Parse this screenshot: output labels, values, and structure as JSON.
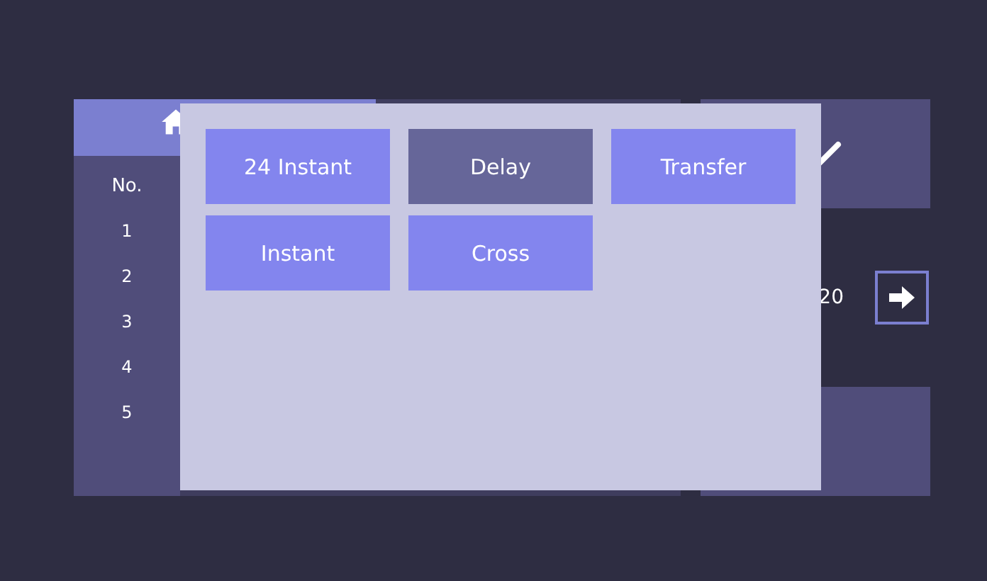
{
  "table": {
    "columns": [
      "No."
    ],
    "rows": [
      "1",
      "2",
      "3",
      "4",
      "5"
    ]
  },
  "side": {
    "value": "20"
  },
  "popup": {
    "options": [
      {
        "label": "24 Instant",
        "selected": false
      },
      {
        "label": "Delay",
        "selected": true
      },
      {
        "label": "Transfer",
        "selected": false
      },
      {
        "label": "Instant",
        "selected": false
      },
      {
        "label": "Cross",
        "selected": false
      }
    ]
  }
}
